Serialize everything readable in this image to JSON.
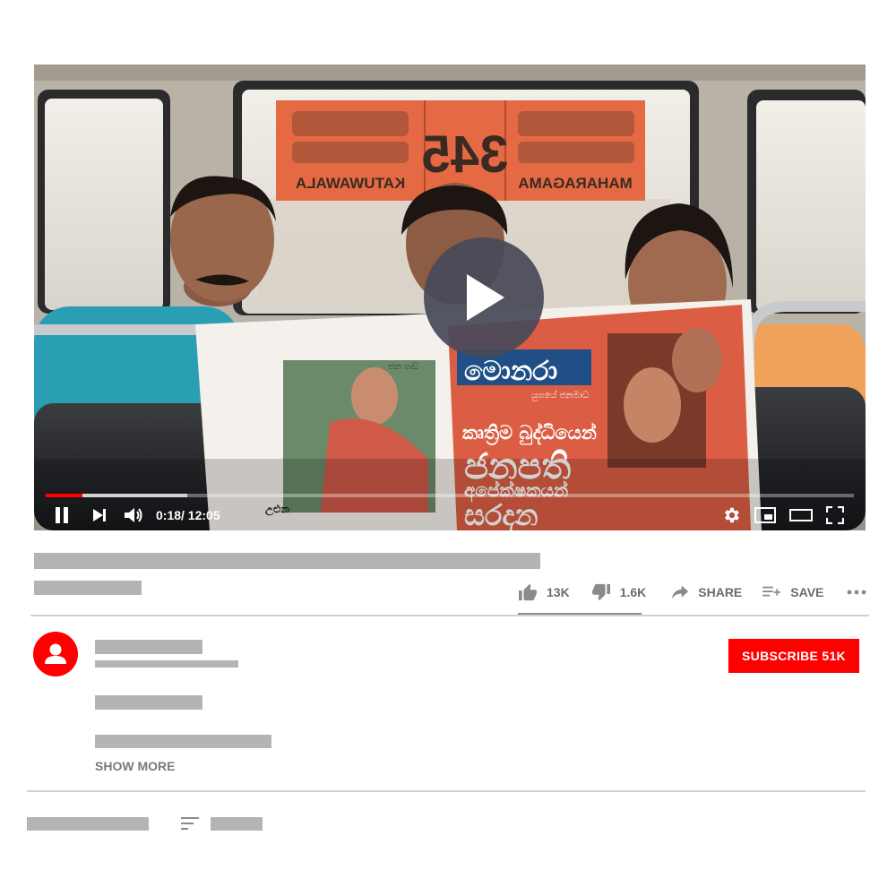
{
  "player": {
    "current_time": "0:18",
    "duration": "/ 12:05",
    "played_fraction": 0.046,
    "buffered_fraction": 0.175,
    "icons": [
      "play-icon",
      "pause-icon",
      "next-icon",
      "volume-icon",
      "settings-icon",
      "miniplayer-icon",
      "theater-icon",
      "fullscreen-icon"
    ],
    "scene": {
      "sign_left": "KATUWAWALA",
      "sign_number": "345",
      "sign_right": "MAHARAGAMA",
      "newspaper_masthead": "මොනරා",
      "newspaper_tagline": "යුගයේ ජනමාධ",
      "headline_line1": "කෘත්‍රිම බුද්ධියෙන්",
      "headline_line2": "ජනපති",
      "headline_line3": "අපේක්ෂකයන්",
      "headline_line4": "සරදන",
      "small_caption_left": "උළුන",
      "small_caption_top": "ජන හඬ"
    }
  },
  "actions": {
    "likes": "13K",
    "dislikes": "1.6K",
    "share": "SHARE",
    "save": "SAVE",
    "icons": [
      "thumbs-up-icon",
      "thumbs-down-icon",
      "share-icon",
      "save-playlist-icon",
      "more-icon"
    ]
  },
  "channel": {
    "subscribe_label": "SUBSCRIBE 51K",
    "avatar_icon": "user-icon"
  },
  "description": {
    "show_more": "SHOW MORE"
  },
  "comments": {
    "sort_icon": "sort-icon"
  },
  "colors": {
    "brand_red": "#ff0000",
    "placeholder_gray": "#b4b4b4",
    "play_button": "#484a58"
  }
}
